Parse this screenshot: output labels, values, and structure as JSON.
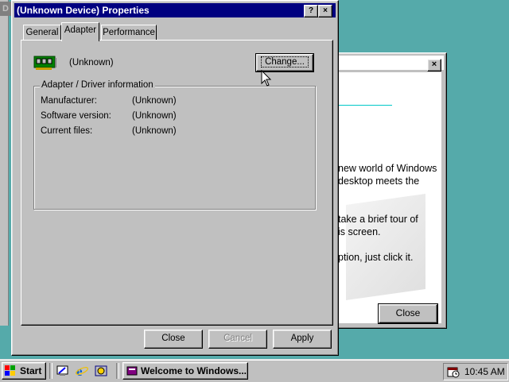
{
  "background_window": {
    "title_letter": "D"
  },
  "welcome": {
    "lines": [
      "new world of Windows",
      "desktop meets the",
      "take a brief tour of",
      "is screen.",
      "ption, just click it."
    ],
    "close_label": "Close"
  },
  "dialog": {
    "title": "(Unknown Device) Properties",
    "help_glyph": "?",
    "close_glyph": "×",
    "tabs": [
      "General",
      "Adapter",
      "Performance"
    ],
    "active_tab": "Adapter",
    "device_name": "(Unknown)",
    "change_label": "Change...",
    "group_title": "Adapter / Driver information",
    "rows": [
      {
        "label": "Manufacturer:",
        "value": "(Unknown)"
      },
      {
        "label": "Software version:",
        "value": "(Unknown)"
      },
      {
        "label": "Current files:",
        "value": "(Unknown)"
      }
    ],
    "buttons": {
      "close": "Close",
      "cancel": "Cancel",
      "apply": "Apply"
    }
  },
  "taskbar": {
    "start_label": "Start",
    "quick_launch": [
      "desktop-icon",
      "internet-explorer-icon",
      "channels-icon"
    ],
    "task_label": "Welcome to Windows...",
    "clock": "10:45 AM"
  },
  "colors": {
    "desktop": "#55aaaa",
    "titlebar": "#000080",
    "face": "#c0c0c0"
  }
}
